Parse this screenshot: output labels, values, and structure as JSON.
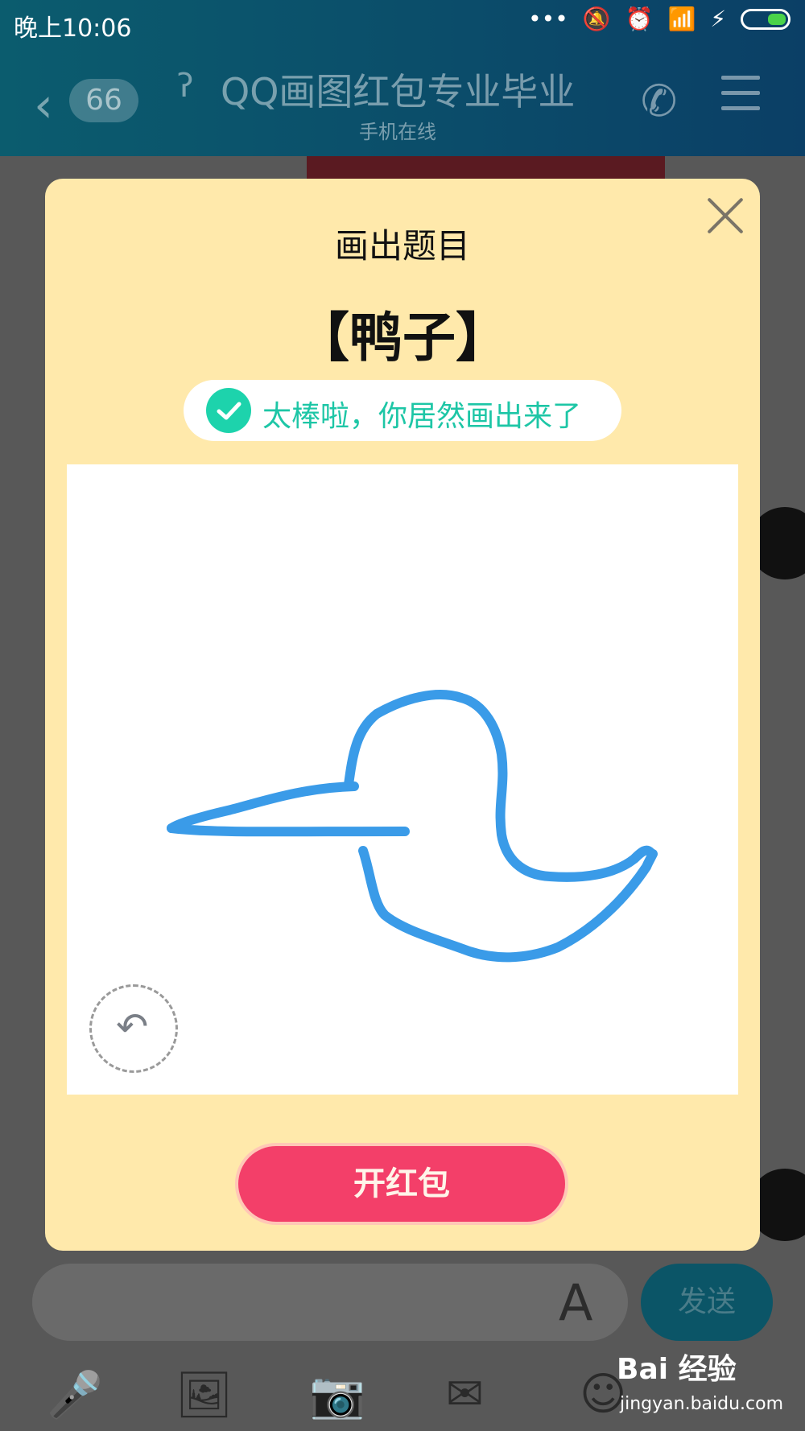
{
  "status_bar": {
    "time": "晚上10:06",
    "icons": [
      "more-dots-icon",
      "mute-bell-icon",
      "alarm-icon",
      "wifi-icon",
      "signal-icon",
      "charging-icon",
      "battery-icon"
    ]
  },
  "header": {
    "back_icon": "back-chevron-icon",
    "unread_count": "66",
    "ear_icon": "ear-icon",
    "title": "QQ画图红包专业毕业",
    "subtitle": "手机在线",
    "phone_icon": "phone-icon",
    "menu_icon": "menu-icon"
  },
  "modal": {
    "title": "画出题目",
    "topic": "【鸭子】",
    "success_message": "太棒啦，你居然画出来了",
    "open_button": "开红包"
  },
  "composer": {
    "send_label": "发送",
    "font_icon": "font-style-icon",
    "toolbar_icons": [
      "microphone-icon",
      "image-icon",
      "camera-icon",
      "red-packet-icon",
      "emoji-icon"
    ]
  },
  "watermark": {
    "brand": "Bai 经验",
    "url": "jingyan.baidu.com"
  },
  "colors": {
    "header": "#0b4d6a",
    "modal_bg": "#ffe9ab",
    "accent_green": "#1dd3ac",
    "button_red": "#f33f69",
    "stroke_blue": "#3a9be8"
  }
}
